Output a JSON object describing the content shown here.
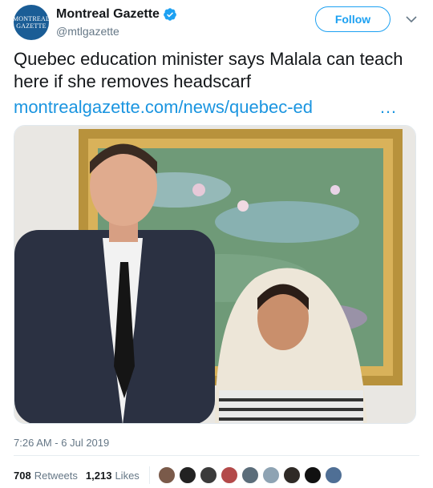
{
  "account": {
    "avatar_line1": "MONTREAL",
    "avatar_line2": "GAZETTE",
    "display_name": "Montreal Gazette",
    "handle": "@mtlgazette"
  },
  "follow_label": "Follow",
  "tweet": {
    "text": "Quebec education minister says Malala can teach here if she removes headscarf",
    "link": "montrealgazette.com/news/quebec-ed",
    "link_more": "…",
    "timestamp": "7:26 AM - 6 Jul 2019"
  },
  "stats": {
    "retweets_count": "708",
    "retweets_label": "Retweets",
    "likes_count": "1,213",
    "likes_label": "Likes"
  },
  "colors": {
    "accent": "#1da1f2",
    "link": "#1b95e0",
    "avatar_bg": "#1a5d96"
  },
  "liker_avatars": [
    "liker-1",
    "liker-2",
    "liker-3",
    "liker-4",
    "liker-5",
    "liker-6",
    "liker-7",
    "liker-8",
    "liker-9"
  ]
}
